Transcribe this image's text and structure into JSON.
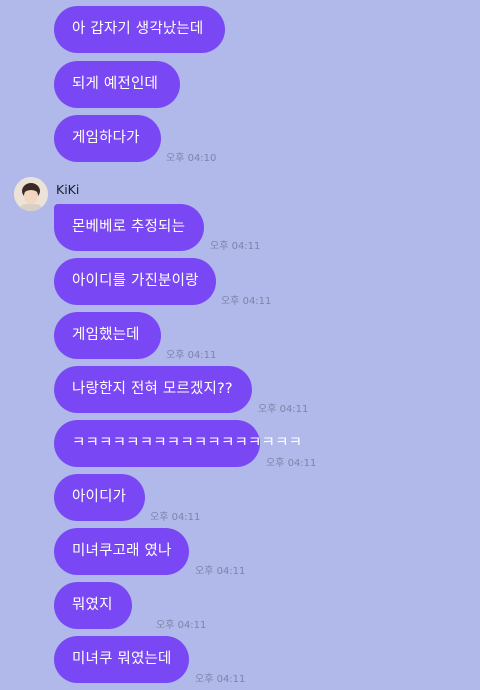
{
  "colors": {
    "background": "#b0b9ea",
    "bubble": "#7a47f4",
    "bubble_text": "#ffffff",
    "timestamp": "#7d83a8"
  },
  "sender": {
    "name": "KiKi",
    "avatar_icon": "profile-photo"
  },
  "messages_group1": [
    {
      "text": "아 갑자기 생각났는데"
    },
    {
      "text": "되게 예전인데"
    },
    {
      "text": "게임하다가",
      "time": "오후 04:10"
    }
  ],
  "messages_group2": [
    {
      "text": "몬베베로 추정되는",
      "time": "오후 04:11"
    },
    {
      "text": "아이디를 가진분이랑",
      "time": "오후 04:11"
    },
    {
      "text": "게임했는데",
      "time": "오후 04:11"
    },
    {
      "text": "나랑한지 전혀 모르겠지??",
      "time": "오후 04:11"
    },
    {
      "text": "ㅋㅋㅋㅋㅋㅋㅋㅋㅋㅋㅋㅋㅋㅋㅋㅋㅋ",
      "time": "오후 04:11"
    },
    {
      "text": "아이디가",
      "time": "오후 04:11"
    },
    {
      "text": "미녀쿠고래 였나",
      "time": "오후 04:11"
    },
    {
      "text": "뭐였지",
      "time": "오후 04:11"
    },
    {
      "text": "미녀쿠 뭐였는데",
      "time": "오후 04:11"
    }
  ]
}
